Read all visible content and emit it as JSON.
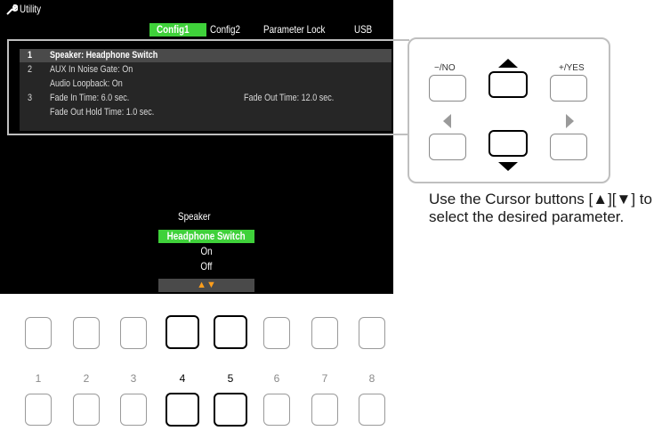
{
  "header": {
    "title": "Utility"
  },
  "tabs": [
    {
      "label": "Config1",
      "active": true
    },
    {
      "label": "Config2",
      "active": false
    },
    {
      "label": "Parameter Lock",
      "active": false
    },
    {
      "label": "USB",
      "active": false
    }
  ],
  "params": [
    {
      "num": "1",
      "text": "Speaker: Headphone Switch",
      "text2": "",
      "selected": true
    },
    {
      "num": "2",
      "text": "AUX In Noise Gate: On",
      "text2": ""
    },
    {
      "num": "",
      "text": "Audio Loopback: On",
      "text2": ""
    },
    {
      "num": "3",
      "text": "Fade In Time: 6.0 sec.",
      "text2": "Fade Out Time: 12.0 sec."
    },
    {
      "num": "",
      "text": "Fade Out Hold Time: 1.0 sec.",
      "text2": ""
    }
  ],
  "popup": {
    "title": "Speaker",
    "options": [
      "Headphone Switch",
      "On",
      "Off"
    ],
    "selected": "Headphone Switch",
    "arrows": "▲▼"
  },
  "cursor_panel": {
    "no_label": "−/NO",
    "yes_label": "+/YES"
  },
  "instruction": "Use the Cursor buttons [▲][▼] to select the desired parameter.",
  "function_buttons": [
    "1",
    "2",
    "3",
    "4",
    "5",
    "6",
    "7",
    "8"
  ],
  "highlighted_buttons": [
    "4",
    "5"
  ],
  "colors": {
    "accent_green": "#3fd13a",
    "arrow_orange": "#ff9e1b",
    "screen_bg": "#000000"
  }
}
